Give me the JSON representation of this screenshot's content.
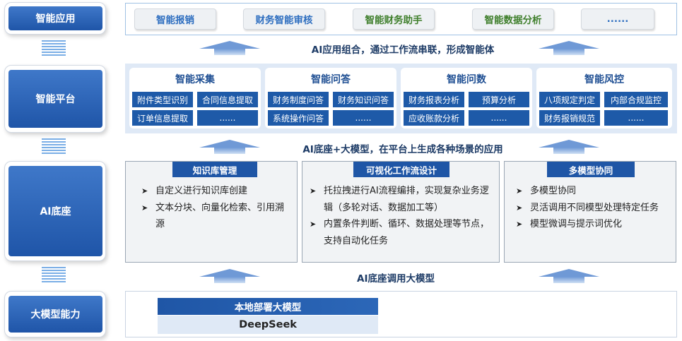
{
  "layers": {
    "app": "智能应用",
    "platform": "智能平台",
    "ai_base": "AI底座",
    "model": "大模型能力"
  },
  "apps": [
    {
      "label": "智能报销",
      "color": "#2f6fc0"
    },
    {
      "label": "财务智能审核",
      "color": "#2f6fc0"
    },
    {
      "label": "智能财务助手",
      "color": "#3f7f2c"
    },
    {
      "label": "智能数据分析",
      "color": "#3f7f2c"
    },
    {
      "label": "......",
      "color": "#2f6fc0"
    }
  ],
  "captions": {
    "app_combo": "AI应用组合，通过工作流串联，形成智能体",
    "base_model": "AI底座+大模型，在平台上生成各种场景的应用",
    "base_call": "AI底座调用大模型"
  },
  "platform_groups": [
    {
      "title": "智能采集",
      "chips": [
        "附件类型识别",
        "合同信息提取",
        "订单信息提取",
        "......"
      ]
    },
    {
      "title": "智能问答",
      "chips": [
        "财务制度问答",
        "财务知识问答",
        "系统操作问答",
        "......"
      ]
    },
    {
      "title": "智能问数",
      "chips": [
        "财务报表分析",
        "预算分析",
        "应收账款分析",
        "......"
      ]
    },
    {
      "title": "智能风控",
      "chips": [
        "八项规定判定",
        "内部合规监控",
        "财务报销规范",
        "......"
      ]
    }
  ],
  "base_panels": [
    {
      "title": "知识库管理",
      "items": [
        "自定义进行知识库创建",
        "文本分块、向量化检索、引用溯源"
      ]
    },
    {
      "title": "可视化工作流设计",
      "items": [
        "托拉拽进行AI流程编排，实现复杂业务逻辑（多轮对话、数据加工等）",
        "内置条件判断、循环、数据处理等节点，支持自动化任务"
      ]
    },
    {
      "title": "多模型协同",
      "items": [
        "多模型协同",
        "灵活调用不同模型处理特定任务",
        "模型微调与提示词优化"
      ]
    }
  ],
  "model": {
    "title": "本地部署大模型",
    "name": "DeepSeek"
  },
  "colors": {
    "primary": "#1f56a6",
    "accent_green": "#3f7f2c",
    "platform_bg": "#dfe9f6"
  }
}
